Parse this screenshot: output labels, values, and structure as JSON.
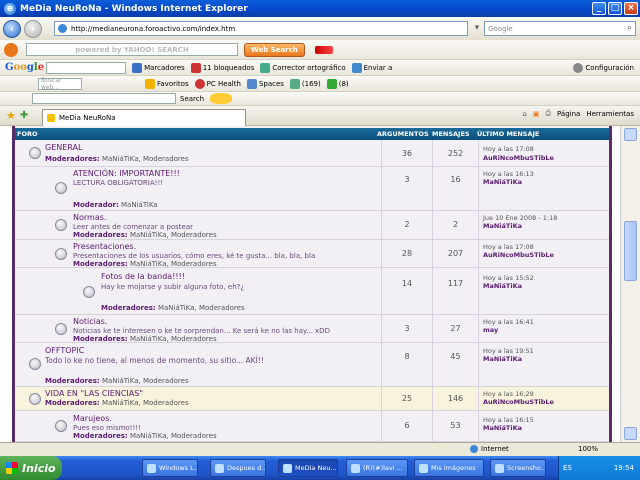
{
  "window": {
    "title": "MeDia NeuRoNa - Windows Internet Explorer"
  },
  "address": {
    "url": "http://medianeurona.foroactivo.com/index.htm"
  },
  "search_box": {
    "placeholder": "Google"
  },
  "toolbars": {
    "yahoo_search_placeholder": "powered by YAHOO! SEARCH",
    "web_search_label": "Web Search",
    "google_items": [
      "Marcadores",
      "11 bloqueados",
      "Corrector ortográfico",
      "Enviar a",
      "Configuración"
    ],
    "misc_placeholder": "Buscar web...",
    "misc_items": [
      "Favoritos",
      "PC Health",
      "Spaces",
      "(169)",
      "(8)"
    ],
    "search_label": "Search"
  },
  "tab": {
    "title": "MeDia NeuRoNa"
  },
  "command_bar": {
    "page_label": "Página",
    "tools_label": "Herramientas"
  },
  "forum": {
    "headers": {
      "forum": "FORO",
      "topics": "ARGUMENTOS",
      "posts": "MENSAJES",
      "last": "ÚLTIMO MENSAJE"
    },
    "rows": [
      {
        "title": "GENERAL",
        "desc": "",
        "mods": "Moderadores:",
        "mods_names": "MaNiáTiKa, Moderadores",
        "topics": "36",
        "posts": "252",
        "time": "Hoy a las 17:08",
        "user": "AuRiNcoMbuSTibLe"
      },
      {
        "title": "ATENCIÓN: IMPORTANTE!!!",
        "desc": "LECTURA OBLIGATORIA!!!",
        "mods": "Moderador:",
        "mods_names": "MaNiáTiKa",
        "topics": "3",
        "posts": "16",
        "time": "Hoy a las 16:13",
        "user": "MaNiáTiKa"
      },
      {
        "title": "Normas.",
        "desc": "Leer antes de comenzar a postear",
        "mods": "Moderadores:",
        "mods_names": "MaNiáTiKa, Moderadores",
        "topics": "2",
        "posts": "2",
        "time": "Jue 10 Ene 2008 - 1:18",
        "user": "MaNiáTiKa"
      },
      {
        "title": "Presentaciones.",
        "desc": "Presentaciones de los usuarios, cómo eres, ké te gusta... bla, bla, bla",
        "mods": "Moderadores:",
        "mods_names": "MaNiáTiKa, Moderadores",
        "topics": "28",
        "posts": "207",
        "time": "Hoy a las 17:08",
        "user": "AuRiNcoMbuSTibLe"
      },
      {
        "title": "Fotos de la banda!!!!",
        "desc": "Hay ke mojarse y subir alguna foto, eh?¿",
        "mods": "Moderadores:",
        "mods_names": "MaNiáTiKa, Moderadores",
        "topics": "14",
        "posts": "117",
        "time": "Hoy a las 15:52",
        "user": "MaNiáTiKa"
      },
      {
        "title": "Noticias.",
        "desc": "Noticias ke te interesen o ke te sorprendan... Ke será ke no las hay... xDD",
        "mods": "Moderadores:",
        "mods_names": "MaNiáTiKa, Moderadores",
        "topics": "3",
        "posts": "27",
        "time": "Hoy a las 16:41",
        "user": "may"
      },
      {
        "title": "OFFTOPIC",
        "desc": "Todo lo ke no tiene, al menos de momento, su sitio... AKÍ!!",
        "mods": "Moderadores:",
        "mods_names": "MaNiáTiKa, Moderadores",
        "topics": "8",
        "posts": "45",
        "time": "Hoy a las 19:51",
        "user": "MaNiáTiKa"
      },
      {
        "title": "VIDA EN \"LAS CIENCIAS\"",
        "desc": "",
        "mods": "Moderadores:",
        "mods_names": "MaNiáTiKa, Moderadores",
        "topics": "25",
        "posts": "146",
        "time": "Hoy a las 16:29",
        "user": "AuRiNcoMbuSTibLe"
      },
      {
        "title": "Marujeos.",
        "desc": "Pues eso mismo!!!!",
        "mods": "Moderadores:",
        "mods_names": "MaNiáTiKa, Moderadores",
        "topics": "6",
        "posts": "53",
        "time": "Hoy a las 16:15",
        "user": "MaNiáTiKa"
      }
    ]
  },
  "status": {
    "zone": "Internet",
    "zoom": "100%"
  },
  "taskbar": {
    "start": "Inicio",
    "items": [
      "Windows L...",
      "Despues d...",
      "MeDia Neu...",
      "(R)(#)lavi ...",
      "Mis imágenes",
      "Screensho..."
    ],
    "lang": "ES",
    "clock": "19:54"
  }
}
